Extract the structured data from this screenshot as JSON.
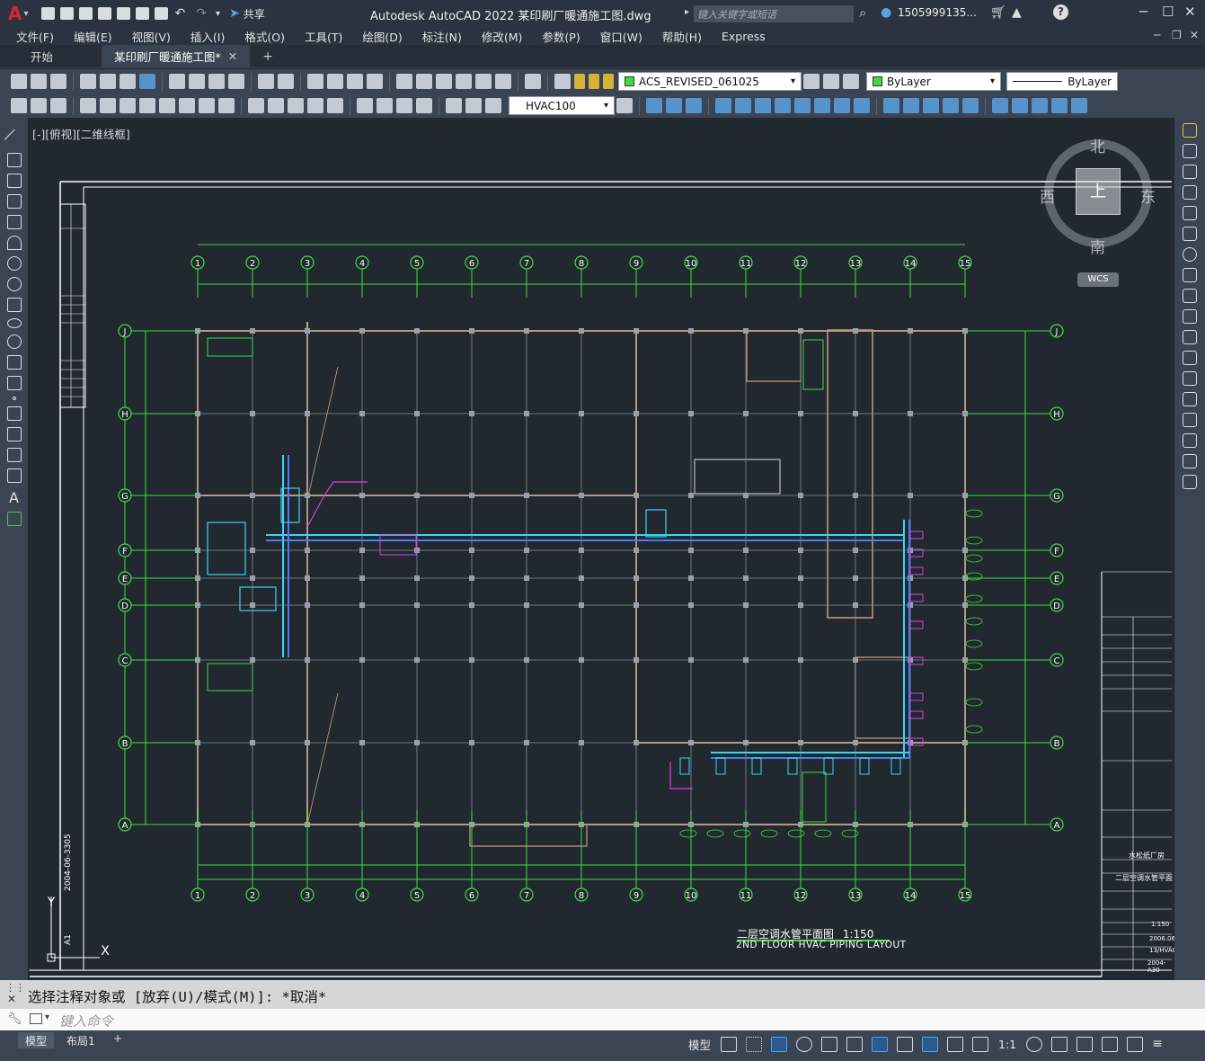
{
  "titlebar": {
    "app_logo": "A",
    "share_label": "共享",
    "title": "Autodesk AutoCAD 2022     某印刷厂暖通施工图.dwg",
    "search_placeholder": "键入关键字或短语",
    "user": "1505999135...",
    "help_icon": "?"
  },
  "menu": [
    "文件(F)",
    "编辑(E)",
    "视图(V)",
    "插入(I)",
    "格式(O)",
    "工具(T)",
    "绘图(D)",
    "标注(N)",
    "修改(M)",
    "参数(P)",
    "窗口(W)",
    "帮助(H)",
    "Express"
  ],
  "tabs": [
    {
      "label": "开始",
      "active": false
    },
    {
      "label": "某印刷厂暖通施工图*",
      "active": true
    }
  ],
  "toolbar": {
    "layer_value": "ACS_REVISED_061025",
    "color_value": "ByLayer",
    "linetype_value": "ByLayer",
    "dimstyle_value": "HVAC100"
  },
  "viewport": {
    "label": "[-][俯视][二维线框]",
    "viewcube": {
      "north": "北",
      "south": "南",
      "east": "东",
      "west": "西",
      "top": "上",
      "wcs": "WCS"
    }
  },
  "drawing": {
    "grid_columns": [
      "1",
      "2",
      "3",
      "4",
      "5",
      "6",
      "7",
      "8",
      "9",
      "10",
      "11",
      "12",
      "13",
      "14",
      "15"
    ],
    "grid_rows": [
      "J",
      "H",
      "G",
      "F",
      "E",
      "D",
      "C",
      "B",
      "A"
    ],
    "title_cn": "二层空调水管平面图",
    "scale": "1:150",
    "title_en": "2ND FLOOR HVAC PIPING LAYOUT",
    "sheet_no": "A1",
    "sheet_date": "2004-06-3305",
    "titleblock": {
      "client_name": "水松纸厂房",
      "drawing_title": "二层空调水管平面",
      "scale": "1:150",
      "date": "2006.06",
      "project_no": "2004-A30",
      "drawing_no": "13/HVAC"
    }
  },
  "command": {
    "history": "选择注释对象或 [放弃(U)/模式(M)]: *取消*",
    "input_placeholder": "键入命令"
  },
  "status": {
    "layout_tabs": [
      {
        "label": "模型",
        "active": true
      },
      {
        "label": "布局1",
        "active": false
      }
    ],
    "model_label": "模型",
    "scale_label": "1:1"
  }
}
